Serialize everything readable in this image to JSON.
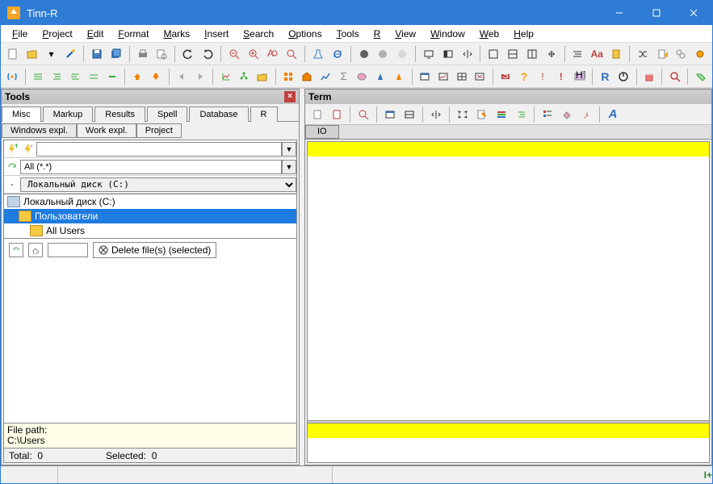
{
  "title": "Tinn-R",
  "menu": [
    "File",
    "Project",
    "Edit",
    "Format",
    "Marks",
    "Insert",
    "Search",
    "Options",
    "Tools",
    "R",
    "View",
    "Window",
    "Web",
    "Help"
  ],
  "tools": {
    "title": "Tools",
    "tabs": [
      "Misc",
      "Markup",
      "Results",
      "Spell",
      "Database",
      "R"
    ],
    "activeTab": 0,
    "subtabs": [
      "Windows expl.",
      "Work expl.",
      "Project"
    ],
    "activeSub": 0,
    "filter": "All (*.*)",
    "drive": "Локальный диск (C:)",
    "tree": [
      {
        "label": "Локальный диск (C:)",
        "type": "drive",
        "indent": 0,
        "sel": false
      },
      {
        "label": "Пользователи",
        "type": "folder",
        "indent": 1,
        "sel": true
      },
      {
        "label": "All Users",
        "type": "folder",
        "indent": 2,
        "sel": false
      }
    ],
    "deleteLabel": "Delete file(s) (selected)",
    "pathLabel": "File path:",
    "pathValue": "C:\\Users",
    "totalLabel": "Total:",
    "totalValue": "0",
    "selectedLabel": "Selected:",
    "selectedValue": "0"
  },
  "term": {
    "title": "Term",
    "ioTab": "IO"
  },
  "statusbar": {
    "insertMode": "I+"
  }
}
